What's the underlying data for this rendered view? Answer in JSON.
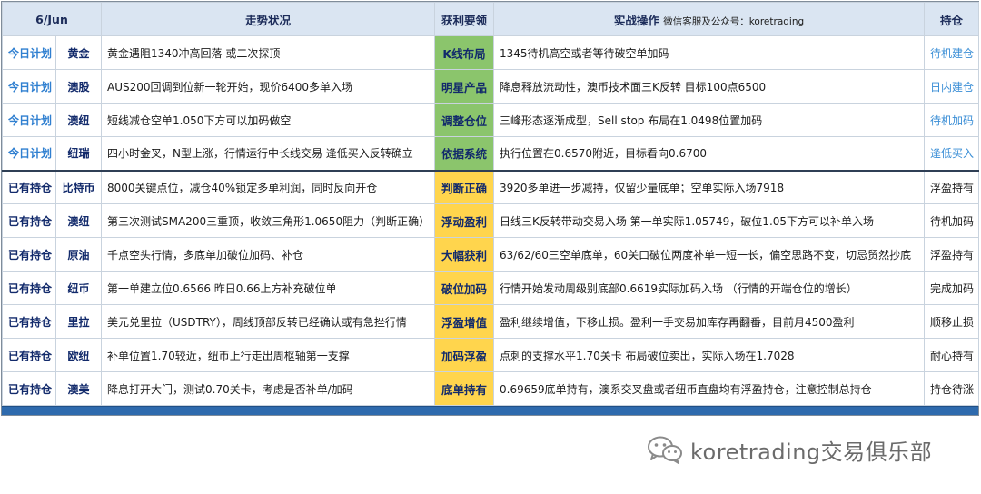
{
  "header": {
    "date": "6/Jun",
    "trend": "走势状况",
    "key_points": "获利要领",
    "action": "实战操作",
    "wechat_note": "微信客服及公众号：koretrading",
    "position": "持仓"
  },
  "rows": [
    {
      "status": "今日计划",
      "asset": "黄金",
      "trend": "黄金遇阻1340冲高回落 或二次探顶",
      "key": "K线布局",
      "action": "1345待机高空或者等待破空单加码",
      "position": "待机建仓"
    },
    {
      "status": "今日计划",
      "asset": "澳股",
      "trend": "AUS200回调到位新一轮开始，现价6400多单入场",
      "key": "明星产品",
      "action": "降息释放流动性，澳币技术面三K反转 目标100点6500",
      "position": "日内建仓"
    },
    {
      "status": "今日计划",
      "asset": "澳纽",
      "trend": "短线减仓空单1.050下方可以加码做空",
      "key": "调整仓位",
      "action": "三峰形态逐渐成型，Sell stop 布局在1.0498位置加码",
      "position": "待机加码"
    },
    {
      "status": "今日计划",
      "asset": "纽瑞",
      "trend": "四小时金叉，N型上涨，行情运行中长线交易 逢低买入反转确立",
      "key": "依据系统",
      "action": "执行位置在0.6570附近，目标看向0.6700",
      "position": "逢低买入"
    },
    {
      "status": "已有持仓",
      "asset": "比特币",
      "trend": "8000关键点位，减仓40%锁定多单利润，同时反向开仓",
      "key": "判断正确",
      "action": "3920多单进一步减持，仅留少量底单；空单实际入场7918",
      "position": "浮盈持有"
    },
    {
      "status": "已有持仓",
      "asset": "澳纽",
      "trend": "第三次测试SMA200三重顶，收敛三角形1.0650阻力（判断正确）",
      "key": "浮动盈利",
      "action": "日线三K反转带动交易入场 第一单实际1.05749，破位1.05下方可以补单入场",
      "position": "待机加码"
    },
    {
      "status": "已有持仓",
      "asset": "原油",
      "trend": "千点空头行情，多底单加破位加码、补仓",
      "key": "大幅获利",
      "action": "63/62/60三空单底单，60关口破位两度补单一短一长，偏空思路不变，切忌贸然抄底",
      "position": "浮盈持有"
    },
    {
      "status": "已有持仓",
      "asset": "纽币",
      "trend": "第一单建立位0.6566 昨日0.66上方补充破位单",
      "key": "破位加码",
      "action": "行情开始发动周级别底部0.6619实际加码入场 （行情的开端仓位的增长）",
      "position": "完成加码"
    },
    {
      "status": "已有持仓",
      "asset": "里拉",
      "trend": "美元兑里拉（USDTRY），周线顶部反转已经确认或有急挫行情",
      "key": "浮盈增值",
      "action": "盈利继续增值，下移止损。盈利一手交易加库存再翻番，目前月4500盈利",
      "position": "顺移止损"
    },
    {
      "status": "已有持仓",
      "asset": "欧纽",
      "trend": "补单位置1.70较近，纽币上行走出周枢轴第一支撑",
      "key": "加码浮盈",
      "action": "点刺的支撑水平1.70关卡 布局破位卖出，实际入场在1.7028",
      "position": "耐心持有"
    },
    {
      "status": "已有持仓",
      "asset": "澳美",
      "trend": "降息打开大门，测试0.70关卡，考虑是否补单/加码",
      "key": "底单持有",
      "action": "0.69659底单持有，澳系交叉盘或者纽币直盘均有浮盈持仓，注意控制总持仓",
      "position": "持仓待涨"
    }
  ],
  "watermark": "koretrading交易俱乐部",
  "colors": {
    "header_bg": "#dae5f2",
    "plan_text": "#2f7fd0",
    "hold_text": "#122a6b",
    "key_green": "#8bc56c",
    "key_yellow": "#ffd54d",
    "footer_bar": "#2e6aad"
  }
}
